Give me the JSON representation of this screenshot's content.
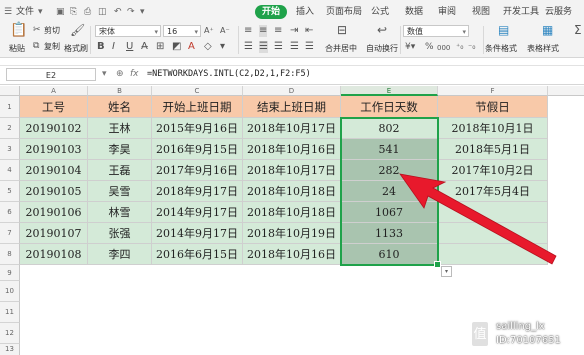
{
  "ribbon": {
    "file_menu": "文件",
    "tabs": [
      "开始",
      "插入",
      "页面布局",
      "公式",
      "数据",
      "审阅",
      "视图",
      "开发工具",
      "云服务"
    ],
    "active_tab": "开始",
    "paste_label": "粘贴",
    "cut_label": "剪切",
    "copy_label": "复制",
    "format_painter_label": "格式刷",
    "font_name": "宋体",
    "font_size": "16",
    "merge_label": "合并居中",
    "wrap_label": "自动换行",
    "number_format": "数值",
    "conditional_format_label": "条件格式",
    "table_style_label": "表格样式",
    "bold": "B",
    "italic": "I",
    "underline": "U",
    "font_color_glyph": "A",
    "percent": "%",
    "comma": "000"
  },
  "formula_bar": {
    "name_box": "E2",
    "fx": "fx",
    "formula": "=NETWORKDAYS.INTL(C2,D2,1,F2:F5)"
  },
  "grid": {
    "columns": [
      "A",
      "B",
      "C",
      "D",
      "E",
      "F"
    ],
    "rows": [
      "1",
      "2",
      "3",
      "4",
      "5",
      "6",
      "7",
      "8",
      "9",
      "10",
      "11",
      "12",
      "13"
    ],
    "selected_column": "E",
    "headers": [
      "工号",
      "姓名",
      "开始上班日期",
      "结束上班日期",
      "工作日天数",
      "节假日"
    ],
    "data": [
      [
        "20190102",
        "王林",
        "2015年9月16日",
        "2018年10月17日",
        "802",
        "2018年10月1日"
      ],
      [
        "20190103",
        "李昊",
        "2016年9月15日",
        "2018年10月16日",
        "541",
        "2018年5月1日"
      ],
      [
        "20190104",
        "王磊",
        "2017年9月16日",
        "2018年10月17日",
        "282",
        "2017年10月2日"
      ],
      [
        "20190105",
        "吴雪",
        "2018年9月17日",
        "2018年10月18日",
        "24",
        "2017年5月4日"
      ],
      [
        "20190106",
        "林雪",
        "2014年9月17日",
        "2018年10月18日",
        "1067",
        ""
      ],
      [
        "20190107",
        "张强",
        "2014年9月17日",
        "2018年10月19日",
        "1133",
        ""
      ],
      [
        "20190108",
        "李四",
        "2016年6月15日",
        "2018年10月16日",
        "610",
        ""
      ]
    ]
  },
  "colors": {
    "accent": "#1fa24a",
    "header_fill": "#f8c9a9",
    "body_fill": "#d4ead8",
    "selected_fill": "#a9c4af",
    "arrow": "#e8192c"
  },
  "watermark": {
    "logo_glyph": "值",
    "user": "sailling_lx",
    "id": "ID:70107651"
  }
}
